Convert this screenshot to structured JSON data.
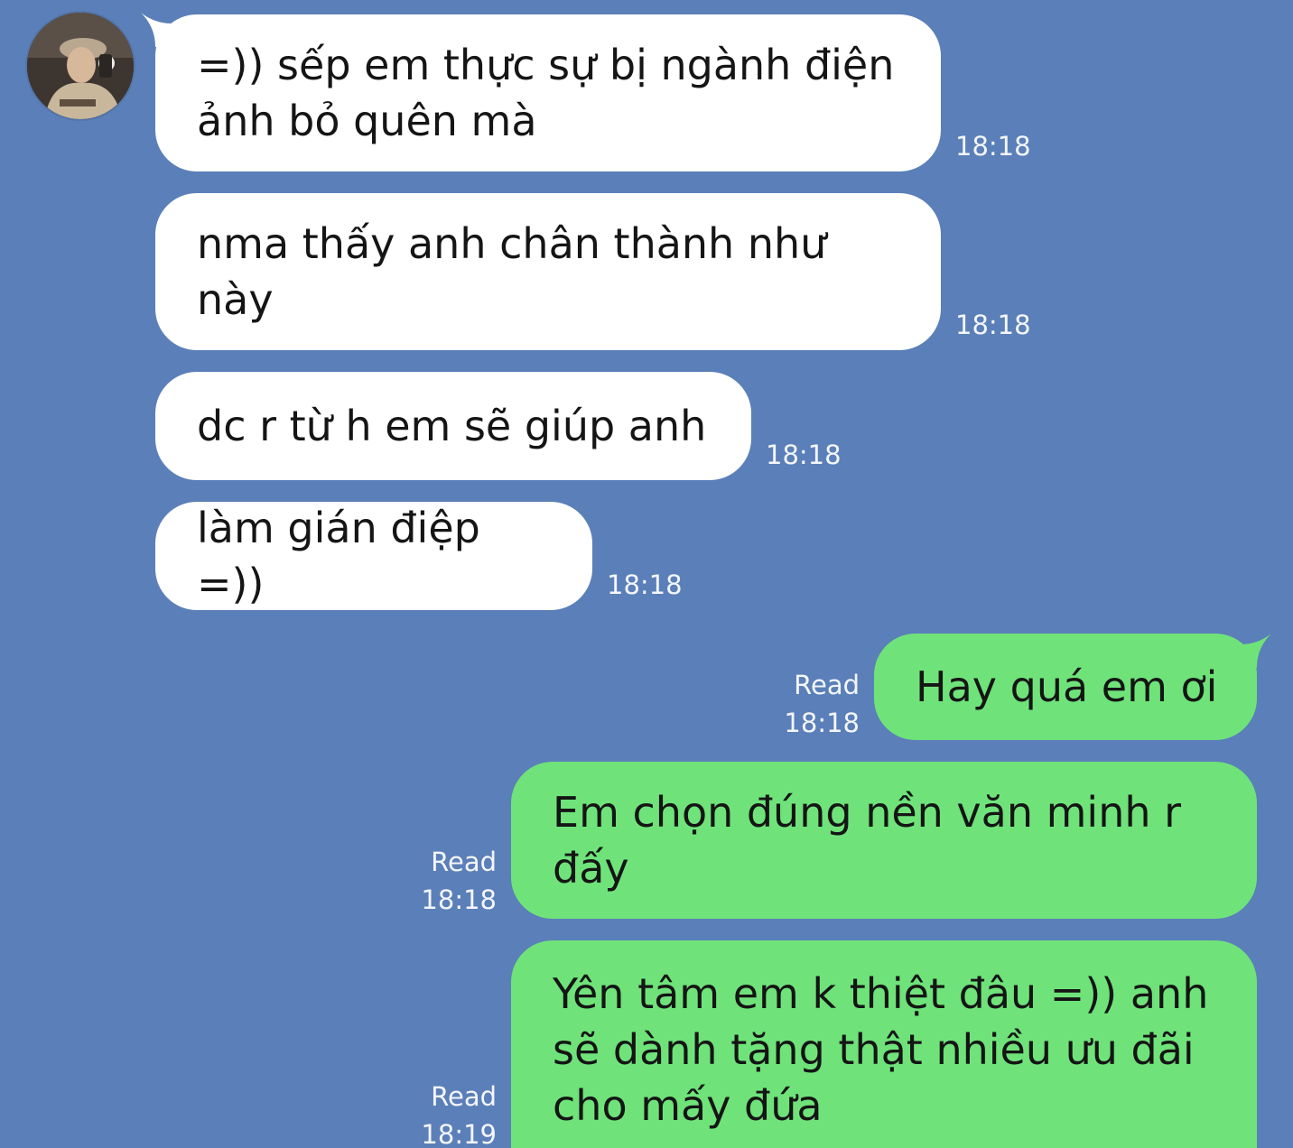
{
  "chat": {
    "incoming": [
      {
        "text": "=)) sếp em thực sự bị ngành điện\nảnh bỏ quên mà",
        "time": "18:18"
      },
      {
        "text": "nma thấy anh chân thành như\nnày",
        "time": "18:18"
      },
      {
        "text": "dc r từ h em sẽ giúp anh",
        "time": "18:18"
      },
      {
        "text": "làm gián điệp =))",
        "time": "18:18"
      }
    ],
    "outgoing": [
      {
        "text": "Hay quá em ơi",
        "status": "Read",
        "time": "18:18"
      },
      {
        "text": "Em chọn đúng nền văn minh r\nđấy",
        "status": "Read",
        "time": "18:18"
      },
      {
        "text": "Yên tâm em k thiệt đâu =)) anh\nsẽ dành tặng thật nhiều ưu đãi\ncho mấy đứa",
        "status": "Read",
        "time": "18:19"
      }
    ]
  },
  "colors": {
    "background": "#5b7fb8",
    "incoming_bubble": "#ffffff",
    "outgoing_bubble": "#6fe37a",
    "meta_text": "#f3f6fb"
  },
  "icons": {
    "avatar": "contact-avatar-photo"
  }
}
